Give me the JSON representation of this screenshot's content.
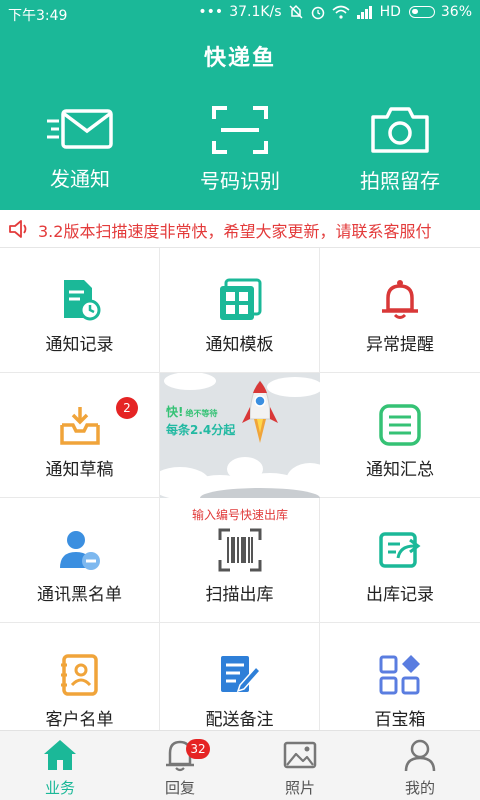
{
  "status_bar": {
    "time": "下午3:49",
    "dots": "•••",
    "speed": "37.1K/s",
    "network": "HD",
    "battery": "36%"
  },
  "app": {
    "title": "快递鱼"
  },
  "quick_actions": [
    {
      "label": "发通知",
      "icon": "envelope-icon"
    },
    {
      "label": "号码识别",
      "icon": "scan-frame-icon"
    },
    {
      "label": "拍照留存",
      "icon": "camera-icon"
    }
  ],
  "notice": {
    "text": "3.2版本扫描速度非常快，希望大家更新，请联系客服付",
    "icon": "speaker-icon"
  },
  "grid": {
    "items": [
      {
        "label": "通知记录",
        "icon": "document-clock-icon",
        "color": "#1bb898"
      },
      {
        "label": "通知模板",
        "icon": "template-grid-icon",
        "color": "#1bb898"
      },
      {
        "label": "异常提醒",
        "icon": "bell-icon",
        "color": "#d93838"
      },
      {
        "label": "通知草稿",
        "icon": "inbox-tray-icon",
        "color": "#f0a43a",
        "badge": "2"
      },
      {
        "label": "通知汇总",
        "icon": "list-summary-icon",
        "color": "#35c275"
      },
      {
        "label": "通讯黑名单",
        "icon": "user-blocked-icon",
        "color": "#3b8fe0"
      },
      {
        "label": "扫描出库",
        "icon": "barcode-icon",
        "color": "#555555"
      },
      {
        "label": "出库记录",
        "icon": "export-record-icon",
        "color": "#1bb898"
      },
      {
        "label": "客户名单",
        "icon": "contacts-book-icon",
        "color": "#f0a43a"
      },
      {
        "label": "配送备注",
        "icon": "note-pen-icon",
        "color": "#2e7fd8"
      },
      {
        "label": "百宝箱",
        "icon": "toolbox-blocks-icon",
        "color": "#5a7de0"
      }
    ],
    "banner": {
      "fast": "快!",
      "fast_sub": "绝不等待",
      "price": "每条2.4分起"
    },
    "scan_hint": "输入编号快速出库"
  },
  "tabs": [
    {
      "label": "业务",
      "icon": "home-icon",
      "active": true
    },
    {
      "label": "回复",
      "icon": "bell-outline-icon",
      "badge": "32"
    },
    {
      "label": "照片",
      "icon": "picture-icon"
    },
    {
      "label": "我的",
      "icon": "person-icon"
    }
  ],
  "colors": {
    "primary": "#1bb898",
    "badge": "#e52424",
    "notice": "#e33b3b"
  }
}
